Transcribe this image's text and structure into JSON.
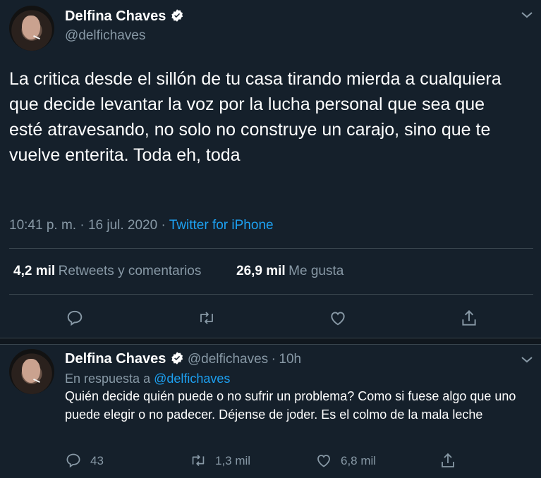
{
  "tweet": {
    "author_name": "Delfina Chaves",
    "author_handle": "@delfichaves",
    "text": "La critica desde el sillón de tu casa tirando mierda a cualquiera que decide levantar la voz por la lucha personal que sea que esté atravesando, no solo no construye un carajo, sino que te vuelve enterita. Toda eh, toda",
    "timestamp": "10:41 p. m. · 16 jul. 2020",
    "separator": " · ",
    "source": "Twitter for iPhone",
    "retweets_count": "4,2 mil",
    "retweets_label": "Retweets y comentarios",
    "likes_count": "26,9 mil",
    "likes_label": "Me gusta"
  },
  "reply": {
    "author_name": "Delfina Chaves",
    "author_handle": "@delfichaves",
    "dot": "·",
    "age": "10h",
    "in_reply_prefix": "En respuesta a",
    "in_reply_handle": "@delfichaves",
    "text": "Quién decide quién puede o no sufrir un problema? Como si fuese algo que uno puede elegir o no padecer. Déjense de joder. Es el colmo de la mala leche",
    "reply_count": "43",
    "retweet_count": "1,3 mil",
    "like_count": "6,8 mil"
  },
  "colors": {
    "background": "#15202b",
    "secondary_text": "#8899a6",
    "link": "#1da1f2",
    "divider": "#38444d"
  },
  "icons": [
    "chevron-down-icon",
    "verified-badge-icon",
    "reply-icon",
    "retweet-icon",
    "like-icon",
    "share-icon"
  ]
}
